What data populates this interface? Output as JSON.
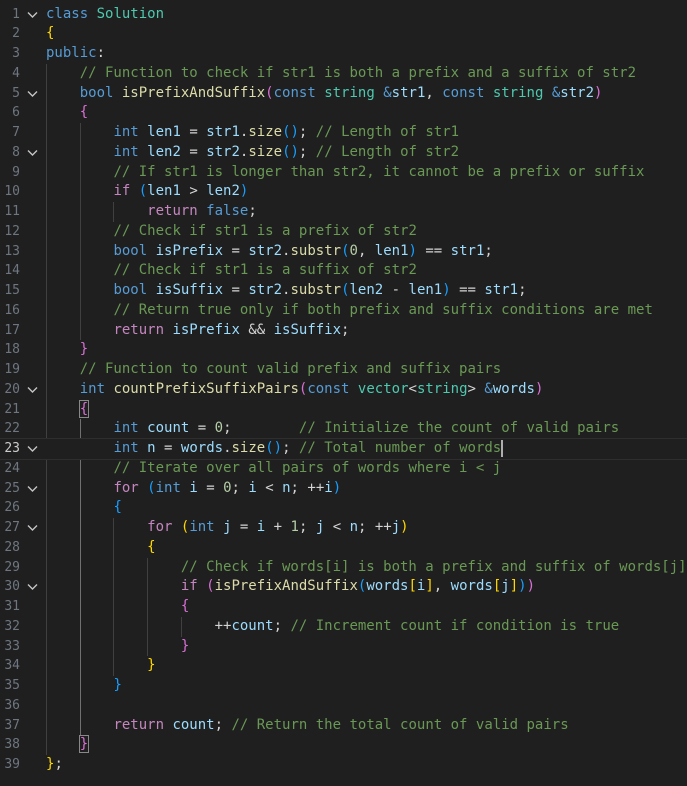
{
  "colors": {
    "background": "#1f1f1f",
    "keyword": "#569cd6",
    "control": "#c586c0",
    "function": "#dcdcaa",
    "variable": "#9cdcfe",
    "type": "#4ec9b0",
    "number": "#b5cea8",
    "comment": "#6a9955",
    "bracket_level1": "#ffd700",
    "bracket_level2": "#da70d6",
    "bracket_level3": "#179fff",
    "line_number": "#6e7681"
  },
  "editor": {
    "active_line": 23,
    "fold_icon": "chevron-down-icon",
    "lines": [
      {
        "n": "1",
        "fold": true,
        "tokens": [
          [
            "kw",
            "class"
          ],
          [
            "op",
            " "
          ],
          [
            "cls",
            "Solution"
          ]
        ]
      },
      {
        "n": "2",
        "fold": false,
        "tokens": [
          [
            "b1",
            "{"
          ]
        ]
      },
      {
        "n": "3",
        "fold": false,
        "tokens": [
          [
            "kw",
            "public"
          ],
          [
            "op",
            ":"
          ]
        ]
      },
      {
        "n": "4",
        "fold": false,
        "tokens": [
          [
            "op",
            "    "
          ],
          [
            "cm",
            "// Function to check if str1 is both a prefix and a suffix of str2"
          ]
        ]
      },
      {
        "n": "5",
        "fold": true,
        "tokens": [
          [
            "op",
            "    "
          ],
          [
            "kw",
            "bool"
          ],
          [
            "op",
            " "
          ],
          [
            "fn",
            "isPrefixAndSuffix"
          ],
          [
            "b2",
            "("
          ],
          [
            "kw",
            "const"
          ],
          [
            "op",
            " "
          ],
          [
            "cls",
            "string"
          ],
          [
            "op",
            " "
          ],
          [
            "kw",
            "&"
          ],
          [
            "var",
            "str1"
          ],
          [
            "op",
            ", "
          ],
          [
            "kw",
            "const"
          ],
          [
            "op",
            " "
          ],
          [
            "cls",
            "string"
          ],
          [
            "op",
            " "
          ],
          [
            "kw",
            "&"
          ],
          [
            "var",
            "str2"
          ],
          [
            "b2",
            ")"
          ]
        ]
      },
      {
        "n": "6",
        "fold": false,
        "tokens": [
          [
            "op",
            "    "
          ],
          [
            "b2",
            "{"
          ]
        ]
      },
      {
        "n": "7",
        "fold": false,
        "tokens": [
          [
            "op",
            "        "
          ],
          [
            "kw",
            "int"
          ],
          [
            "op",
            " "
          ],
          [
            "var",
            "len1"
          ],
          [
            "op",
            " = "
          ],
          [
            "var",
            "str1"
          ],
          [
            "op",
            "."
          ],
          [
            "fn",
            "size"
          ],
          [
            "b3",
            "()"
          ],
          [
            "op",
            "; "
          ],
          [
            "cm",
            "// Length of str1"
          ]
        ]
      },
      {
        "n": "8",
        "fold": true,
        "tokens": [
          [
            "op",
            "        "
          ],
          [
            "kw",
            "int"
          ],
          [
            "op",
            " "
          ],
          [
            "var",
            "len2"
          ],
          [
            "op",
            " = "
          ],
          [
            "var",
            "str2"
          ],
          [
            "op",
            "."
          ],
          [
            "fn",
            "size"
          ],
          [
            "b3",
            "()"
          ],
          [
            "op",
            "; "
          ],
          [
            "cm",
            "// Length of str2"
          ]
        ]
      },
      {
        "n": "9",
        "fold": false,
        "tokens": [
          [
            "op",
            "        "
          ],
          [
            "cm",
            "// If str1 is longer than str2, it cannot be a prefix or suffix"
          ]
        ]
      },
      {
        "n": "10",
        "fold": false,
        "tokens": [
          [
            "op",
            "        "
          ],
          [
            "ctl",
            "if"
          ],
          [
            "op",
            " "
          ],
          [
            "b3",
            "("
          ],
          [
            "var",
            "len1"
          ],
          [
            "op",
            " > "
          ],
          [
            "var",
            "len2"
          ],
          [
            "b3",
            ")"
          ]
        ]
      },
      {
        "n": "11",
        "fold": false,
        "tokens": [
          [
            "op",
            "            "
          ],
          [
            "ctl",
            "return"
          ],
          [
            "op",
            " "
          ],
          [
            "kw",
            "false"
          ],
          [
            "op",
            ";"
          ]
        ]
      },
      {
        "n": "12",
        "fold": false,
        "tokens": [
          [
            "op",
            "        "
          ],
          [
            "cm",
            "// Check if str1 is a prefix of str2"
          ]
        ]
      },
      {
        "n": "13",
        "fold": false,
        "tokens": [
          [
            "op",
            "        "
          ],
          [
            "kw",
            "bool"
          ],
          [
            "op",
            " "
          ],
          [
            "var",
            "isPrefix"
          ],
          [
            "op",
            " = "
          ],
          [
            "var",
            "str2"
          ],
          [
            "op",
            "."
          ],
          [
            "fn",
            "substr"
          ],
          [
            "b3",
            "("
          ],
          [
            "num",
            "0"
          ],
          [
            "op",
            ", "
          ],
          [
            "var",
            "len1"
          ],
          [
            "b3",
            ")"
          ],
          [
            "op",
            " == "
          ],
          [
            "var",
            "str1"
          ],
          [
            "op",
            ";"
          ]
        ]
      },
      {
        "n": "14",
        "fold": false,
        "tokens": [
          [
            "op",
            "        "
          ],
          [
            "cm",
            "// Check if str1 is a suffix of str2"
          ]
        ]
      },
      {
        "n": "15",
        "fold": false,
        "tokens": [
          [
            "op",
            "        "
          ],
          [
            "kw",
            "bool"
          ],
          [
            "op",
            " "
          ],
          [
            "var",
            "isSuffix"
          ],
          [
            "op",
            " = "
          ],
          [
            "var",
            "str2"
          ],
          [
            "op",
            "."
          ],
          [
            "fn",
            "substr"
          ],
          [
            "b3",
            "("
          ],
          [
            "var",
            "len2"
          ],
          [
            "op",
            " - "
          ],
          [
            "var",
            "len1"
          ],
          [
            "b3",
            ")"
          ],
          [
            "op",
            " == "
          ],
          [
            "var",
            "str1"
          ],
          [
            "op",
            ";"
          ]
        ]
      },
      {
        "n": "16",
        "fold": false,
        "tokens": [
          [
            "op",
            "        "
          ],
          [
            "cm",
            "// Return true only if both prefix and suffix conditions are met"
          ]
        ]
      },
      {
        "n": "17",
        "fold": false,
        "tokens": [
          [
            "op",
            "        "
          ],
          [
            "ctl",
            "return"
          ],
          [
            "op",
            " "
          ],
          [
            "var",
            "isPrefix"
          ],
          [
            "op",
            " && "
          ],
          [
            "var",
            "isSuffix"
          ],
          [
            "op",
            ";"
          ]
        ]
      },
      {
        "n": "18",
        "fold": false,
        "tokens": [
          [
            "op",
            "    "
          ],
          [
            "b2",
            "}"
          ]
        ]
      },
      {
        "n": "19",
        "fold": false,
        "tokens": [
          [
            "op",
            "    "
          ],
          [
            "cm",
            "// Function to count valid prefix and suffix pairs"
          ]
        ]
      },
      {
        "n": "20",
        "fold": true,
        "tokens": [
          [
            "op",
            "    "
          ],
          [
            "kw",
            "int"
          ],
          [
            "op",
            " "
          ],
          [
            "fn",
            "countPrefixSuffixPairs"
          ],
          [
            "b2",
            "("
          ],
          [
            "kw",
            "const"
          ],
          [
            "op",
            " "
          ],
          [
            "cls",
            "vector"
          ],
          [
            "op",
            "<"
          ],
          [
            "cls",
            "string"
          ],
          [
            "op",
            "> "
          ],
          [
            "kw",
            "&"
          ],
          [
            "var",
            "words"
          ],
          [
            "b2",
            ")"
          ]
        ]
      },
      {
        "n": "21",
        "fold": false,
        "tokens": [
          [
            "op",
            "    "
          ],
          [
            "b2m",
            "{"
          ]
        ]
      },
      {
        "n": "22",
        "fold": false,
        "tokens": [
          [
            "op",
            "        "
          ],
          [
            "kw",
            "int"
          ],
          [
            "op",
            " "
          ],
          [
            "var",
            "count"
          ],
          [
            "op",
            " = "
          ],
          [
            "num",
            "0"
          ],
          [
            "op",
            ";        "
          ],
          [
            "cm",
            "// Initialize the count of valid pairs"
          ]
        ]
      },
      {
        "n": "23",
        "fold": true,
        "tokens": [
          [
            "op",
            "        "
          ],
          [
            "kw",
            "int"
          ],
          [
            "op",
            " "
          ],
          [
            "var",
            "n"
          ],
          [
            "op",
            " = "
          ],
          [
            "var",
            "words"
          ],
          [
            "op",
            "."
          ],
          [
            "fn",
            "size"
          ],
          [
            "b3",
            "()"
          ],
          [
            "op",
            "; "
          ],
          [
            "cm",
            "// Total number of words"
          ],
          [
            "cursor",
            ""
          ]
        ]
      },
      {
        "n": "24",
        "fold": false,
        "tokens": [
          [
            "op",
            "        "
          ],
          [
            "cm",
            "// Iterate over all pairs of words where i < j"
          ]
        ]
      },
      {
        "n": "25",
        "fold": true,
        "tokens": [
          [
            "op",
            "        "
          ],
          [
            "ctl",
            "for"
          ],
          [
            "op",
            " "
          ],
          [
            "b3",
            "("
          ],
          [
            "kw",
            "int"
          ],
          [
            "op",
            " "
          ],
          [
            "var",
            "i"
          ],
          [
            "op",
            " = "
          ],
          [
            "num",
            "0"
          ],
          [
            "op",
            "; "
          ],
          [
            "var",
            "i"
          ],
          [
            "op",
            " < "
          ],
          [
            "var",
            "n"
          ],
          [
            "op",
            "; ++"
          ],
          [
            "var",
            "i"
          ],
          [
            "b3",
            ")"
          ]
        ]
      },
      {
        "n": "26",
        "fold": false,
        "tokens": [
          [
            "op",
            "        "
          ],
          [
            "b3",
            "{"
          ]
        ]
      },
      {
        "n": "27",
        "fold": true,
        "tokens": [
          [
            "op",
            "            "
          ],
          [
            "ctl",
            "for"
          ],
          [
            "op",
            " "
          ],
          [
            "b1",
            "("
          ],
          [
            "kw",
            "int"
          ],
          [
            "op",
            " "
          ],
          [
            "var",
            "j"
          ],
          [
            "op",
            " = "
          ],
          [
            "var",
            "i"
          ],
          [
            "op",
            " + "
          ],
          [
            "num",
            "1"
          ],
          [
            "op",
            "; "
          ],
          [
            "var",
            "j"
          ],
          [
            "op",
            " < "
          ],
          [
            "var",
            "n"
          ],
          [
            "op",
            "; ++"
          ],
          [
            "var",
            "j"
          ],
          [
            "b1",
            ")"
          ]
        ]
      },
      {
        "n": "28",
        "fold": false,
        "tokens": [
          [
            "op",
            "            "
          ],
          [
            "b1",
            "{"
          ]
        ]
      },
      {
        "n": "29",
        "fold": false,
        "tokens": [
          [
            "op",
            "                "
          ],
          [
            "cm",
            "// Check if words[i] is both a prefix and suffix of words[j]"
          ]
        ]
      },
      {
        "n": "30",
        "fold": true,
        "tokens": [
          [
            "op",
            "                "
          ],
          [
            "ctl",
            "if"
          ],
          [
            "op",
            " "
          ],
          [
            "b2",
            "("
          ],
          [
            "fn",
            "isPrefixAndSuffix"
          ],
          [
            "b3",
            "("
          ],
          [
            "var",
            "words"
          ],
          [
            "b1",
            "["
          ],
          [
            "var",
            "i"
          ],
          [
            "b1",
            "]"
          ],
          [
            "op",
            ", "
          ],
          [
            "var",
            "words"
          ],
          [
            "b1",
            "["
          ],
          [
            "var",
            "j"
          ],
          [
            "b1",
            "]"
          ],
          [
            "b3",
            ")"
          ],
          [
            "b2",
            ")"
          ]
        ]
      },
      {
        "n": "31",
        "fold": false,
        "tokens": [
          [
            "op",
            "                "
          ],
          [
            "b2",
            "{"
          ]
        ]
      },
      {
        "n": "32",
        "fold": false,
        "tokens": [
          [
            "op",
            "                    ++"
          ],
          [
            "var",
            "count"
          ],
          [
            "op",
            "; "
          ],
          [
            "cm",
            "// Increment count if condition is true"
          ]
        ]
      },
      {
        "n": "33",
        "fold": false,
        "tokens": [
          [
            "op",
            "                "
          ],
          [
            "b2",
            "}"
          ]
        ]
      },
      {
        "n": "34",
        "fold": false,
        "tokens": [
          [
            "op",
            "            "
          ],
          [
            "b1",
            "}"
          ]
        ]
      },
      {
        "n": "35",
        "fold": false,
        "tokens": [
          [
            "op",
            "        "
          ],
          [
            "b3",
            "}"
          ]
        ]
      },
      {
        "n": "36",
        "fold": false,
        "tokens": []
      },
      {
        "n": "37",
        "fold": false,
        "tokens": [
          [
            "op",
            "        "
          ],
          [
            "ctl",
            "return"
          ],
          [
            "op",
            " "
          ],
          [
            "var",
            "count"
          ],
          [
            "op",
            "; "
          ],
          [
            "cm",
            "// Return the total count of valid pairs"
          ]
        ]
      },
      {
        "n": "38",
        "fold": false,
        "tokens": [
          [
            "op",
            "    "
          ],
          [
            "b2m",
            "}"
          ]
        ]
      },
      {
        "n": "39",
        "fold": false,
        "tokens": [
          [
            "b1",
            "}"
          ],
          [
            "op",
            ";"
          ]
        ]
      }
    ]
  }
}
